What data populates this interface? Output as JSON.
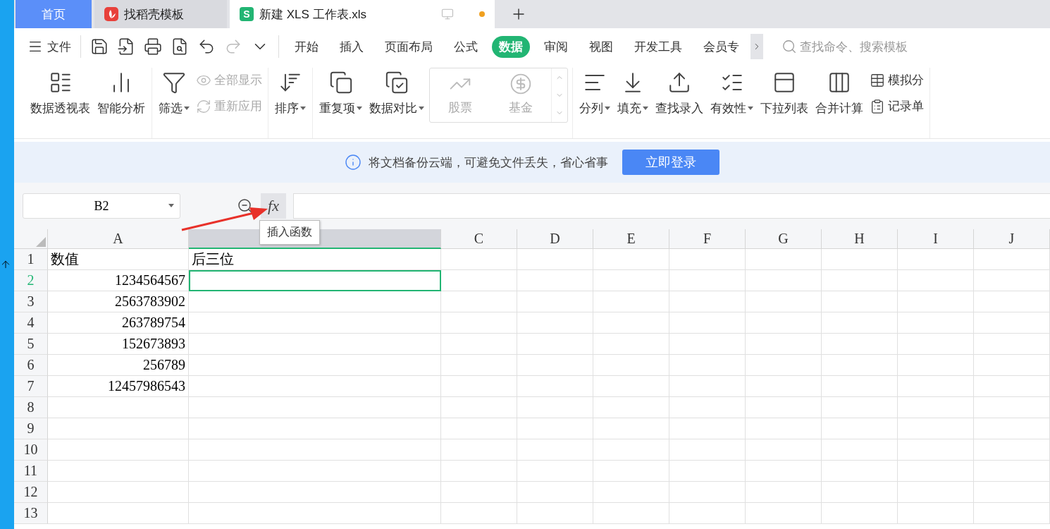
{
  "tabs": [
    {
      "label": "首页",
      "kind": "home",
      "selected": false
    },
    {
      "label": "找稻壳模板",
      "kind": "template",
      "selected": false
    },
    {
      "label": "新建 XLS 工作表.xls",
      "kind": "sheet",
      "badge": "S",
      "selected": true
    }
  ],
  "menu": {
    "file": "文件",
    "tabs": [
      {
        "label": "开始",
        "selected": false
      },
      {
        "label": "插入",
        "selected": false
      },
      {
        "label": "页面布局",
        "selected": false
      },
      {
        "label": "公式",
        "selected": false
      },
      {
        "label": "数据",
        "selected": true
      },
      {
        "label": "审阅",
        "selected": false
      },
      {
        "label": "视图",
        "selected": false
      },
      {
        "label": "开发工具",
        "selected": false
      },
      {
        "label": "会员专",
        "selected": false
      }
    ],
    "search": {
      "placeholder": "查找命令、搜索模板"
    }
  },
  "ribbon": {
    "groups": [
      {
        "items": [
          {
            "kind": "large",
            "label": "数据透视表",
            "dropdown": false
          },
          {
            "kind": "large",
            "label": "智能分析",
            "dropdown": false
          }
        ]
      },
      {
        "items": [
          {
            "kind": "large",
            "label": "筛选",
            "dropdown": true
          },
          {
            "kind": "stack",
            "items": [
              {
                "label": "全部显示",
                "disabled": true
              },
              {
                "label": "重新应用",
                "disabled": true
              }
            ]
          }
        ]
      },
      {
        "items": [
          {
            "kind": "large",
            "label": "排序",
            "dropdown": true
          }
        ]
      },
      {
        "items": [
          {
            "kind": "large",
            "label": "重复项",
            "dropdown": true
          },
          {
            "kind": "large",
            "label": "数据对比",
            "dropdown": true
          },
          {
            "kind": "gallery",
            "entries": [
              {
                "label": "股票",
                "disabled": true
              },
              {
                "label": "基金",
                "disabled": true
              }
            ]
          }
        ]
      },
      {
        "items": [
          {
            "kind": "large",
            "label": "分列",
            "dropdown": true
          },
          {
            "kind": "large",
            "label": "填充",
            "dropdown": true
          },
          {
            "kind": "large",
            "label": "查找录入",
            "dropdown": false
          },
          {
            "kind": "large",
            "label": "有效性",
            "dropdown": true
          },
          {
            "kind": "large",
            "label": "下拉列表",
            "dropdown": false
          },
          {
            "kind": "large",
            "label": "合并计算",
            "dropdown": false
          },
          {
            "kind": "stack",
            "items": [
              {
                "label": "模拟分",
                "disabled": false
              },
              {
                "label": "记录单",
                "disabled": false
              }
            ]
          }
        ]
      }
    ]
  },
  "notice": {
    "text": "将文档备份云端，可避免文件丢失，省心省事",
    "button": "立即登录"
  },
  "formula_bar": {
    "cell_ref": "B2",
    "fx": "fx",
    "tooltip": "插入函数"
  },
  "sheet": {
    "columns": [
      {
        "label": "A",
        "selected": false
      },
      {
        "selected": true
      },
      {
        "label": "C",
        "selected": false
      },
      {
        "label": "D",
        "selected": false
      },
      {
        "label": "E",
        "selected": false
      },
      {
        "label": "F",
        "selected": false
      },
      {
        "label": "G",
        "selected": false
      },
      {
        "label": "H",
        "selected": false
      },
      {
        "label": "I",
        "selected": false
      },
      {
        "label": "J",
        "selected": false
      }
    ],
    "rows": [
      {
        "label": "1",
        "selected": false,
        "cells": [
          "数值",
          "后三位"
        ]
      },
      {
        "label": "2",
        "selected": true,
        "cells": [
          "1234564567"
        ]
      },
      {
        "label": "3",
        "selected": false,
        "cells": [
          "2563783902"
        ]
      },
      {
        "label": "4",
        "selected": false,
        "cells": [
          "263789754"
        ]
      },
      {
        "label": "5",
        "selected": false,
        "cells": [
          "152673893"
        ]
      },
      {
        "label": "6",
        "selected": false,
        "cells": [
          "256789"
        ]
      },
      {
        "label": "7",
        "selected": false,
        "cells": [
          "12457986543"
        ]
      },
      {
        "label": "8",
        "selected": false,
        "cells": []
      },
      {
        "label": "9",
        "selected": false,
        "cells": []
      },
      {
        "label": "10",
        "selected": false,
        "cells": []
      },
      {
        "label": "11",
        "selected": false,
        "cells": []
      },
      {
        "label": "12",
        "selected": false,
        "cells": []
      },
      {
        "label": "13",
        "selected": false,
        "cells": []
      }
    ]
  }
}
